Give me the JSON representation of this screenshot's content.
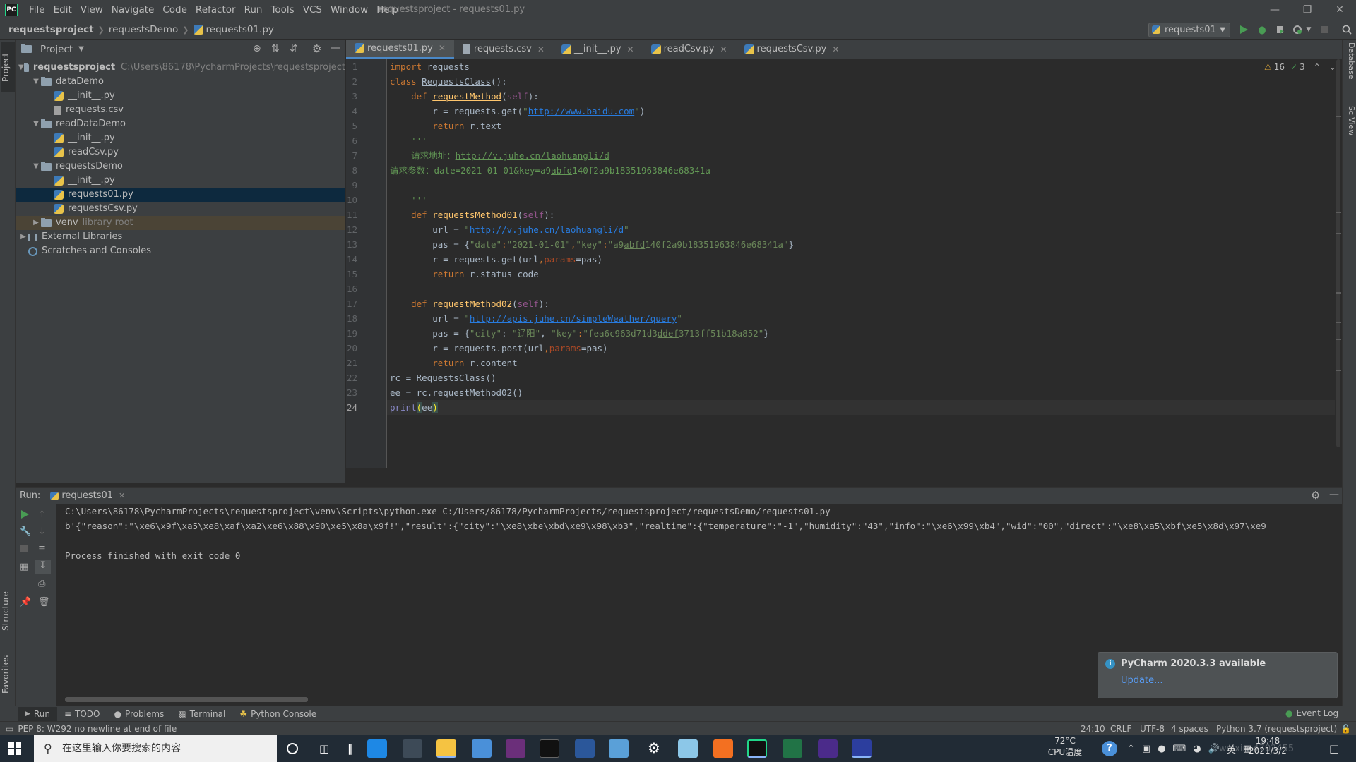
{
  "menubar": {
    "items": [
      "File",
      "Edit",
      "View",
      "Navigate",
      "Code",
      "Refactor",
      "Run",
      "Tools",
      "VCS",
      "Window",
      "Help"
    ],
    "title": "requestsproject - requests01.py"
  },
  "navbar": {
    "crumbs": [
      "requestsproject",
      "requestsDemo",
      "requests01.py"
    ],
    "run_config": "requests01"
  },
  "left_stripe": {
    "project": "Project",
    "structure": "Structure",
    "favorites": "Favorites"
  },
  "right_stripe": {
    "database": "Database",
    "sciview": "SciView"
  },
  "project": {
    "header": "Project",
    "root": {
      "name": "requestsproject",
      "path": "C:\\Users\\86178\\PycharmProjects\\requestsproject"
    },
    "tree": [
      {
        "label": "dataDemo",
        "type": "folder",
        "indent": 1,
        "expanded": true
      },
      {
        "label": "__init__.py",
        "type": "py",
        "indent": 2
      },
      {
        "label": "requests.csv",
        "type": "csv",
        "indent": 2
      },
      {
        "label": "readDataDemo",
        "type": "folder",
        "indent": 1,
        "expanded": true
      },
      {
        "label": "__init__.py",
        "type": "py",
        "indent": 2
      },
      {
        "label": "readCsv.py",
        "type": "py",
        "indent": 2
      },
      {
        "label": "requestsDemo",
        "type": "folder",
        "indent": 1,
        "expanded": true
      },
      {
        "label": "__init__.py",
        "type": "py",
        "indent": 2
      },
      {
        "label": "requests01.py",
        "type": "py",
        "indent": 2,
        "selected": true
      },
      {
        "label": "requestsCsv.py",
        "type": "py",
        "indent": 2
      }
    ],
    "venv": {
      "label": "venv",
      "hint": "library root"
    },
    "external": "External Libraries",
    "scratches": "Scratches and Consoles"
  },
  "tabs": [
    {
      "label": "requests01.py",
      "active": true
    },
    {
      "label": "requests.csv"
    },
    {
      "label": "__init__.py"
    },
    {
      "label": "readCsv.py"
    },
    {
      "label": "requestsCsv.py"
    }
  ],
  "inspections": {
    "warnings": "16",
    "ok": "3"
  },
  "editor": {
    "line_numbers": [
      "1",
      "2",
      "3",
      "4",
      "5",
      "6",
      "7",
      "8",
      "9",
      "10",
      "11",
      "12",
      "13",
      "14",
      "15",
      "16",
      "17",
      "18",
      "19",
      "20",
      "21",
      "22",
      "23",
      "24"
    ],
    "current_line": 24
  },
  "run": {
    "label": "Run:",
    "tab": "requests01",
    "cmd": "C:\\Users\\86178\\PycharmProjects\\requestsproject\\venv\\Scripts\\python.exe C:/Users/86178/PycharmProjects/requestsproject/requestsDemo/requests01.py",
    "output": "b'{\"reason\":\"\\xe6\\x9f\\xa5\\xe8\\xaf\\xa2\\xe6\\x88\\x90\\xe5\\x8a\\x9f!\",\"result\":{\"city\":\"\\xe8\\xbe\\xbd\\xe9\\x98\\xb3\",\"realtime\":{\"temperature\":\"-1\",\"humidity\":\"43\",\"info\":\"\\xe6\\x99\\xb4\",\"wid\":\"00\",\"direct\":\"\\xe8\\xa5\\xbf\\xe5\\x8d\\x97\\xe9",
    "exit": "Process finished with exit code 0"
  },
  "tool_tabs": [
    "Run",
    "TODO",
    "Problems",
    "Terminal",
    "Python Console"
  ],
  "event_log": "Event Log",
  "status": {
    "message": "PEP 8: W292 no newline at end of file",
    "position": "24:10",
    "line_sep": "CRLF",
    "encoding": "UTF-8",
    "indent": "4 spaces",
    "interpreter": "Python 3.7 (requestsproject)"
  },
  "notification": {
    "title": "PyCharm 2020.3.3 available",
    "link": "Update..."
  },
  "taskbar": {
    "search": "在这里输入你要搜索的内容",
    "weather": "72°C",
    "cpu": "CPU温度",
    "time": "19:48",
    "date": "2021/3/2",
    "ime": "英",
    "watermark": "weixin_4702455"
  }
}
